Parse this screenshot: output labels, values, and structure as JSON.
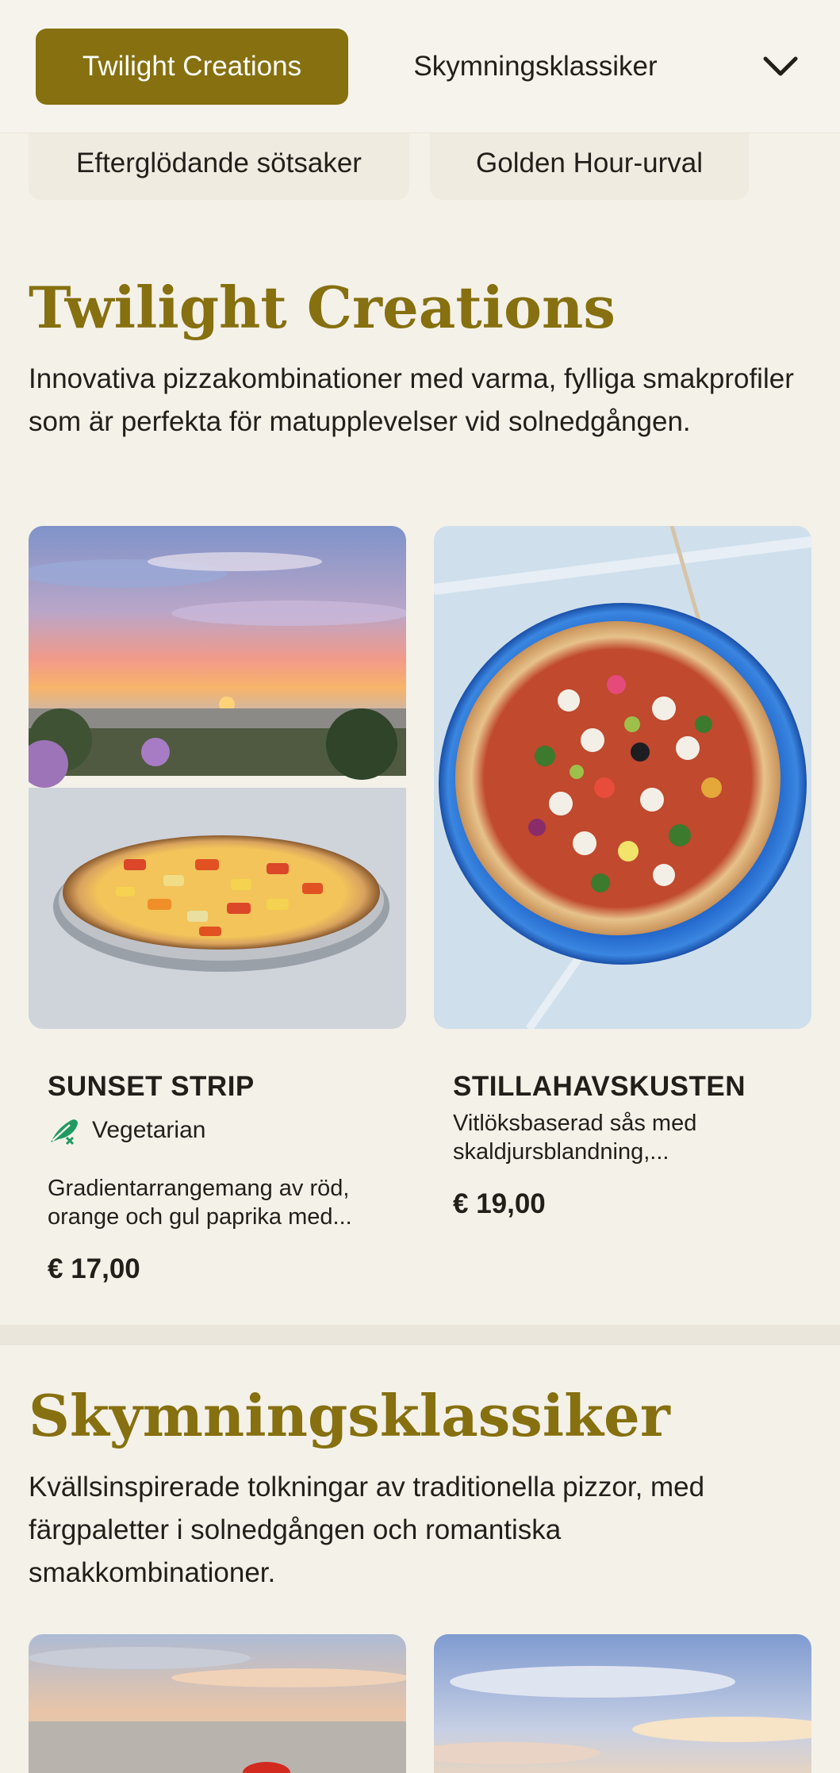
{
  "nav": {
    "active_chip": "Twilight Creations",
    "second_chip": "Skymningsklassiker",
    "row2_chip_1": "Efterglödande sötsaker",
    "row2_chip_2": "Golden Hour-urval",
    "expand_icon": "chevron-down-icon"
  },
  "sections": [
    {
      "title": "Twilight Creations",
      "description": "Innovativa pizzakombinationer med varma, fylliga smakprofiler som är perfekta för matupplevelser vid solnedgången.",
      "items": [
        {
          "name": "SUNSET STRIP",
          "tag": "Vegetarian",
          "tag_icon": "vegetarian-leaf-icon",
          "description": "Gradientarrangemang av röd, orange och gul paprika med...",
          "price": "€ 17,00"
        },
        {
          "name": "STILLAHAVSKUSTEN",
          "description": "Vitlöksbaserad sås med skaldjursblandning,...",
          "price": "€ 19,00"
        }
      ]
    },
    {
      "title": "Skymningsklassiker",
      "description": "Kvällsinspirerade tolkningar av traditionella pizzor, med färgpaletter i solnedgången och romantiska smakkombinationer."
    }
  ],
  "colors": {
    "accent": "#86700f",
    "background": "#f4f1e9",
    "tag_green": "#1f9a62"
  }
}
